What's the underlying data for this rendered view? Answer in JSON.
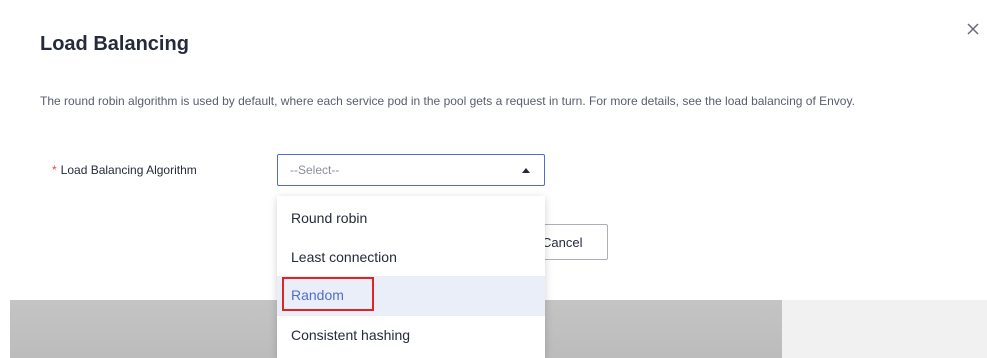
{
  "dialog": {
    "title": "Load Balancing",
    "description": "The round robin algorithm is used by default, where each service pod in the pool gets a request in turn. For more details, see the load balancing of Envoy."
  },
  "form": {
    "required_mark": "*",
    "algorithm_label": "Load Balancing Algorithm",
    "select_placeholder": "--Select--"
  },
  "dropdown": {
    "options": [
      {
        "label": "Round robin"
      },
      {
        "label": "Least connection"
      },
      {
        "label": "Random"
      },
      {
        "label": "Consistent hashing"
      }
    ],
    "highlighted_index": 2
  },
  "footer": {
    "cancel_label": "Cancel"
  },
  "colors": {
    "accent": "#526ecc",
    "required": "#e54545",
    "highlight_frame": "#e02424",
    "hover_background": "#e9eef9"
  },
  "icons": {
    "close": "close-icon",
    "caret": "caret-up-icon"
  }
}
